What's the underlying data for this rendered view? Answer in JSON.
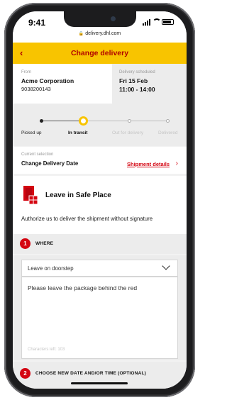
{
  "status_bar": {
    "time": "9:41",
    "url": "delivery.dhl.com"
  },
  "header": {
    "back_icon": "chevron-left-icon",
    "back_glyph": "‹",
    "title": "Change delivery"
  },
  "shipment": {
    "from_label": "From",
    "from_company": "Acme Corporation",
    "tracking_number": "9038200143",
    "scheduled_label": "Delivery scheduled",
    "scheduled_date": "Fri 15 Feb",
    "scheduled_time": "11:00 - 14:00"
  },
  "progress": {
    "steps": [
      {
        "label": "Picked up",
        "state": "done"
      },
      {
        "label": "In transit",
        "state": "active"
      },
      {
        "label": "Out for delivery",
        "state": "future"
      },
      {
        "label": "Delivered",
        "state": "future"
      }
    ]
  },
  "selection": {
    "label": "Current selection",
    "value": "Change Delivery Date",
    "link": "Shipment details",
    "link_glyph": "›"
  },
  "option": {
    "icon": "safe-place-icon",
    "title": "Leave in Safe Place",
    "description": "Authorize us to deliver the shipment without signature"
  },
  "sections": [
    {
      "number": "1",
      "title": "WHERE"
    },
    {
      "number": "2",
      "title": "CHOOSE NEW DATE AND/OR TIME (OPTIONAL)"
    }
  ],
  "form": {
    "location_value": "Leave on doorstep",
    "instructions_value": "Please leave the package behind the red",
    "characters_left": "Characters left: 103"
  },
  "colors": {
    "brand_yellow": "#f8c400",
    "brand_red": "#d40511",
    "header_text": "#b00000"
  }
}
